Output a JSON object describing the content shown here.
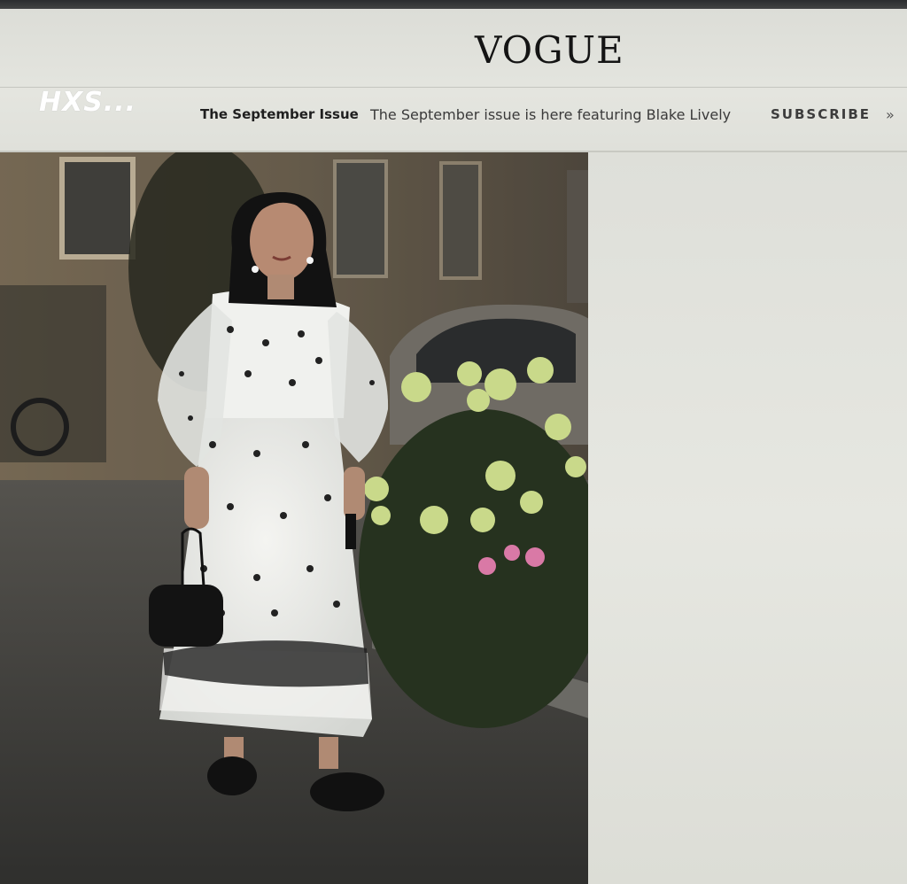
{
  "header": {
    "logo": "VOGUE",
    "watermark": "HXS...",
    "nav_issue_label": "The September Issue",
    "nav_promo_text": "The September issue is here featuring Blake Lively",
    "nav_subscribe_label": "SUBSCRIBE",
    "nav_arrow": "»"
  },
  "colors": {
    "header_bg": "#e2e3dd",
    "logo": "#141414",
    "sidebar_bg": "#e3e4de"
  },
  "icons": {
    "subscribe_arrow": "double-chevron-right-icon"
  }
}
